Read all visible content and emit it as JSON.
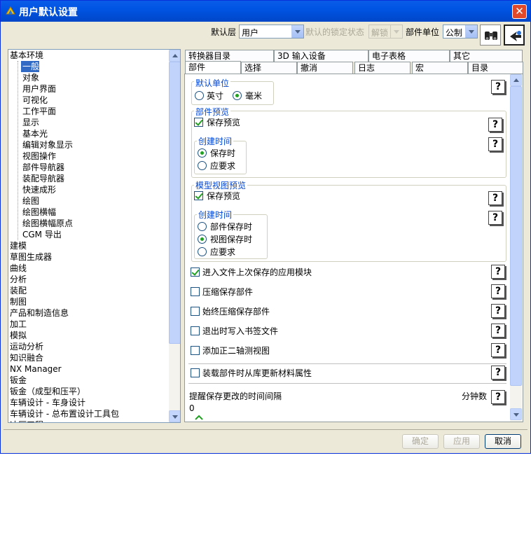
{
  "window": {
    "title": "用户默认设置",
    "close_glyph": "✕"
  },
  "toolbar": {
    "layer_label": "默认层",
    "layer_value": "用户",
    "lock_label": "默认的锁定状态",
    "lock_value": "解锁",
    "unit_label": "部件单位",
    "unit_value": "公制",
    "search_icon": "binoculars-icon",
    "pointer_icon": "pointer-icon"
  },
  "tree": {
    "items": [
      "基本环境",
      "一般",
      "对象",
      "用户界面",
      "可视化",
      "工作平面",
      "显示",
      "基本光",
      "编辑对象显示",
      "视图操作",
      "部件导航器",
      "装配导航器",
      "快速成形",
      "绘图",
      "绘图横幅",
      "绘图横幅原点",
      "CGM 导出",
      "建模",
      "草图生成器",
      "曲线",
      "分析",
      "装配",
      "制图",
      "产品和制造信息",
      "加工",
      "模拟",
      "运动分析",
      "知识融合",
      "NX Manager",
      "钣金",
      "钣金（成型和压平）",
      "车辆设计 - 车身设计",
      "车辆设计 - 总布置设计工具包",
      "冲压工程"
    ],
    "selected": "一般"
  },
  "tabs_row1": [
    "转换器目录",
    "3D 输入设备",
    "电子表格",
    "其它"
  ],
  "tabs_row2": [
    "部件",
    "选择",
    "撤消",
    "日志",
    "宏",
    "目录"
  ],
  "active_tab": "部件",
  "panel": {
    "default_unit": {
      "title": "默认单位",
      "inch": "英寸",
      "mm": "毫米",
      "selected": "毫米"
    },
    "part_preview": {
      "title": "部件预览",
      "save_preview": "保存预览",
      "save_preview_checked": true,
      "create_time_title": "创建时间",
      "on_save": "保存时",
      "on_demand": "应要求",
      "selected": "保存时"
    },
    "model_view_preview": {
      "title": "模型视图预览",
      "save_preview": "保存预览",
      "save_preview_checked": true,
      "create_time_title": "创建时间",
      "part_save": "部件保存时",
      "view_save": "视图保存时",
      "on_demand": "应要求",
      "selected": "视图保存时"
    },
    "options": [
      {
        "label": "进入文件上次保存的应用模块",
        "checked": true
      },
      {
        "label": "压缩保存部件",
        "checked": false
      },
      {
        "label": "始终压缩保存部件",
        "checked": false
      },
      {
        "label": "退出时写入书签文件",
        "checked": false
      },
      {
        "label": "添加正二轴测视图",
        "checked": false
      },
      {
        "label": "装载部件时从库更新材料属性",
        "checked": false
      }
    ],
    "reminder_label": "提醒保存更改的时间间隔",
    "reminder_unit": "分钟数",
    "reminder_value": "0",
    "help_glyph": "?"
  },
  "buttons": {
    "ok": "确定",
    "apply": "应用",
    "cancel": "取消"
  }
}
